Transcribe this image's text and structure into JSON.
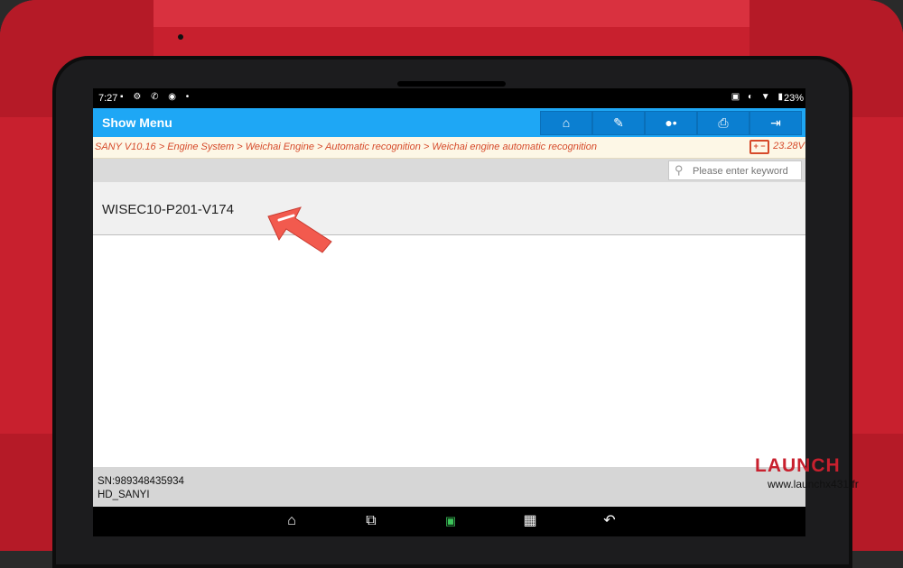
{
  "status": {
    "time": "7:27",
    "battery": "23%"
  },
  "header": {
    "title": "Show Menu",
    "buttons": [
      {
        "name": "home",
        "glyph": "⌂"
      },
      {
        "name": "report",
        "glyph": "✎"
      },
      {
        "name": "feedback",
        "glyph": "💬"
      },
      {
        "name": "print",
        "glyph": "⎙"
      },
      {
        "name": "exit",
        "glyph": "⇥"
      }
    ]
  },
  "breadcrumb": {
    "path": "SANY V10.16 > Engine System > Weichai Engine > Automatic recognition  > Weichai engine automatic recognition",
    "voltage": "23.28V"
  },
  "search": {
    "placeholder": "Please enter keyword"
  },
  "list": {
    "items": [
      {
        "label": "WISEC10-P201-V174"
      }
    ]
  },
  "info": {
    "sn": "SN:989348435934",
    "model": "HD_SANYI"
  },
  "navbar": {
    "items": [
      "home",
      "recent-apps",
      "vci",
      "screenshot",
      "back"
    ]
  },
  "brand": {
    "name": "LAUNCH",
    "url": "www.launchx431.fr"
  },
  "colors": {
    "accent": "#1ea7f5",
    "case": "#c8202e",
    "breadcrumb_text": "#d64a2a"
  }
}
